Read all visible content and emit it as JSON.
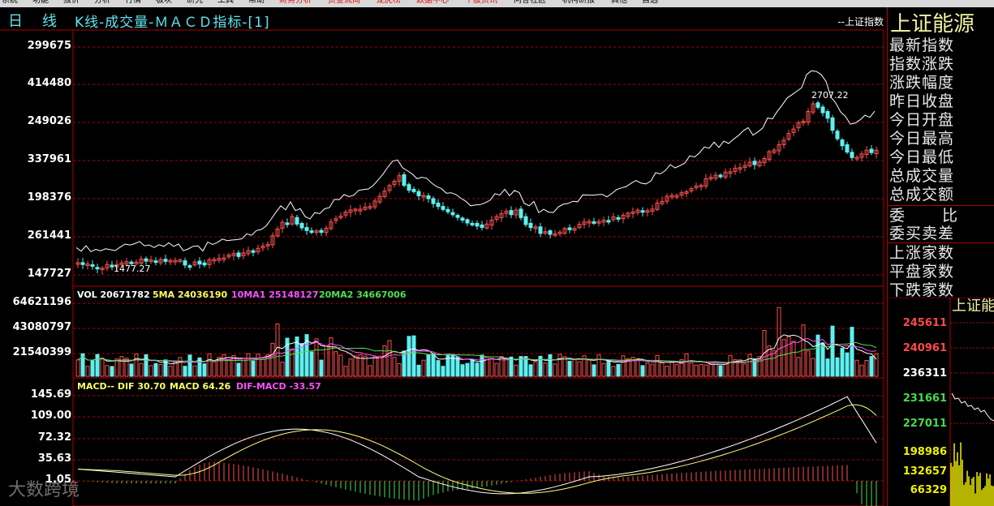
{
  "menu": {
    "items": [
      "系统",
      "功能",
      "报价",
      "分析",
      "行情",
      "板块",
      "研究",
      "工具",
      "帮助",
      "财务分析",
      "资金流向",
      "龙虎榜",
      "数据中心",
      "个股资讯",
      "问答社区",
      "机构研报",
      "其他",
      "自选"
    ],
    "red_items": [
      9,
      10,
      11,
      12,
      13
    ]
  },
  "header": {
    "period_1": "日",
    "period_2": "线",
    "chart_title": "K线-成交量-ＭＡＣＤ指标-[1]",
    "index_tag": "--上证指数"
  },
  "right_panel": {
    "title": "上证能源",
    "fields": [
      "最新指数",
      "指数涨跌",
      "涨跌幅度",
      "昨日收盘",
      "今日开盘",
      "今日最高",
      "今日最低",
      "总成交量",
      "总成交额"
    ],
    "fields2": [
      "委",
      "比",
      "委买卖差"
    ],
    "fields3": [
      "上涨家数",
      "平盘家数",
      "下跌家数"
    ],
    "mini_title": "上证能",
    "mini_labels": [
      "245611",
      "240961",
      "236311",
      "231661",
      "227011"
    ],
    "mini_vol_labels": [
      "198986",
      "132657",
      "66329"
    ],
    "colors": {
      "up": "#ff4a4a",
      "flat": "#ffffff",
      "down": "#4ad84a",
      "vol": "#f0f000"
    }
  },
  "kline": {
    "y_labels": [
      "299675",
      "414480",
      "249026",
      "337961",
      "198376",
      "261441",
      "147727"
    ],
    "max_mark": "2707.22",
    "min_mark": "1477.27"
  },
  "volume": {
    "legend": {
      "vol": "VOL 20671782",
      "ma5": "5MA 24036190",
      "ma10": "10MA1 25148127",
      "ma20": "20MA2 34667006"
    },
    "y_labels": [
      "64621196",
      "43080797",
      "21540399"
    ]
  },
  "macd": {
    "legend": {
      "title": "MACD-- DIF 30.70",
      "macd": "MACD 64.26",
      "diff": "DIF-MACD -33.57"
    },
    "y_labels": [
      "145.69",
      "109.00",
      "72.32",
      "35.63",
      "1.05"
    ]
  },
  "colors": {
    "up": "#ff5050",
    "down": "#5ef0f0",
    "ma5": "#ffffff",
    "ma10": "#ff50ff",
    "ma20": "#50e050",
    "grid": "#b00000",
    "legend_vol": "#ffffff",
    "legend_ma5": "#ffff60",
    "legend_ma10": "#ff50ff",
    "legend_ma20": "#50e050"
  },
  "watermark": "大数跨境"
}
